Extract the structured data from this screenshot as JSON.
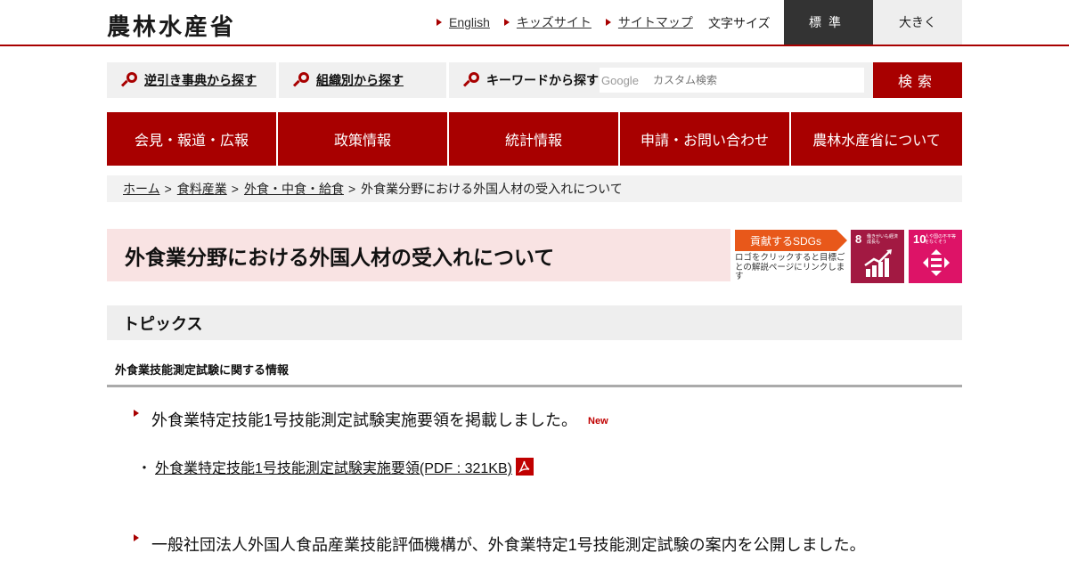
{
  "header": {
    "logo": "農林水産省",
    "links": [
      {
        "label": "English"
      },
      {
        "label": "キッズサイト"
      },
      {
        "label": "サイトマップ"
      }
    ],
    "font_size_label": "文字サイズ",
    "font_size_standard": "標準",
    "font_size_large": "大きく"
  },
  "search": {
    "tabs": [
      {
        "label": "逆引き事典から探す"
      },
      {
        "label": "組織別から探す"
      },
      {
        "label": "キーワードから探す"
      }
    ],
    "google_mark": "Google",
    "placeholder": "カスタム検索",
    "button": "検索"
  },
  "nav": {
    "items": [
      {
        "label": "会見・報道・広報"
      },
      {
        "label": "政策情報"
      },
      {
        "label": "統計情報"
      },
      {
        "label": "申請・お問い合わせ"
      },
      {
        "label": "農林水産省について"
      }
    ]
  },
  "breadcrumb": {
    "items": [
      {
        "label": "ホーム"
      },
      {
        "label": "食料産業"
      },
      {
        "label": "外食・中食・給食"
      }
    ],
    "separator": ">",
    "current": "外食業分野における外国人材の受入れについて"
  },
  "page": {
    "title": "外食業分野における外国人材の受入れについて"
  },
  "sdgs": {
    "badge": "貢献するSDGs",
    "note": "ロゴをクリックすると目標ごとの解説ページにリンクします",
    "goals": [
      {
        "number": "8",
        "text": "働きがいも経済成長も",
        "color": "#a21942",
        "icon": "growth-chart-icon"
      },
      {
        "number": "10",
        "text": "人や国の不平等をなくそう",
        "color": "#dd1367",
        "icon": "equality-arrows-icon"
      }
    ]
  },
  "topics": {
    "heading": "トピックス",
    "subheading": "外食業技能測定試験に関する情報",
    "items": [
      {
        "text": "外食業特定技能1号技能測定試験実施要領を掲載しました。",
        "badge": "New"
      },
      {
        "text": "一般社団法人外国人食品産業技能評価機構が、外食業特定1号技能測定試験の案内を公開しました。"
      }
    ],
    "pdf": {
      "bullet": "・",
      "label": "外食業特定技能1号技能測定試験実施要領(PDF : 321KB)",
      "icon": "pdf-icon"
    }
  },
  "colors": {
    "brand": "#a80000",
    "title_bg": "#f9e3e3",
    "sdg_orange": "#e8581a"
  }
}
